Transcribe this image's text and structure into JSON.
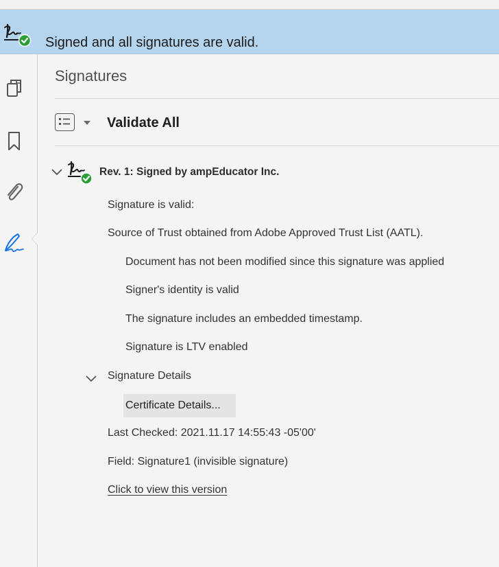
{
  "banner": {
    "message": "Signed and all signatures are valid.",
    "icon": "signature-valid-icon"
  },
  "rail": {
    "icons": [
      "pages-icon",
      "bookmark-icon",
      "attachment-icon",
      "signature-pen-icon"
    ],
    "active": "signature-pen-icon",
    "active_color": "#1473e6"
  },
  "panel": {
    "title": "Signatures",
    "validate_all": "Validate All",
    "revision": {
      "label": "Rev. 1: Signed by ampEducator Inc.",
      "status": "Signature is valid:",
      "trust": "Source of Trust obtained from Adobe Approved Trust List (AATL).",
      "checks": [
        "Document has not been modified since this signature was applied",
        "Signer's identity is valid",
        "The signature includes an embedded timestamp.",
        "Signature is LTV enabled"
      ],
      "details_label": "Signature Details",
      "certificate_button": "Certificate Details...",
      "last_checked": "Last Checked: 2021.11.17 14:55:43 -05'00'",
      "field": "Field: Signature1 (invisible signature)",
      "view_version_link": "Click to view this version"
    }
  },
  "colors": {
    "banner_bg": "#b5d5ef",
    "valid_green": "#2d9d3a",
    "accent": "#1473e6"
  }
}
